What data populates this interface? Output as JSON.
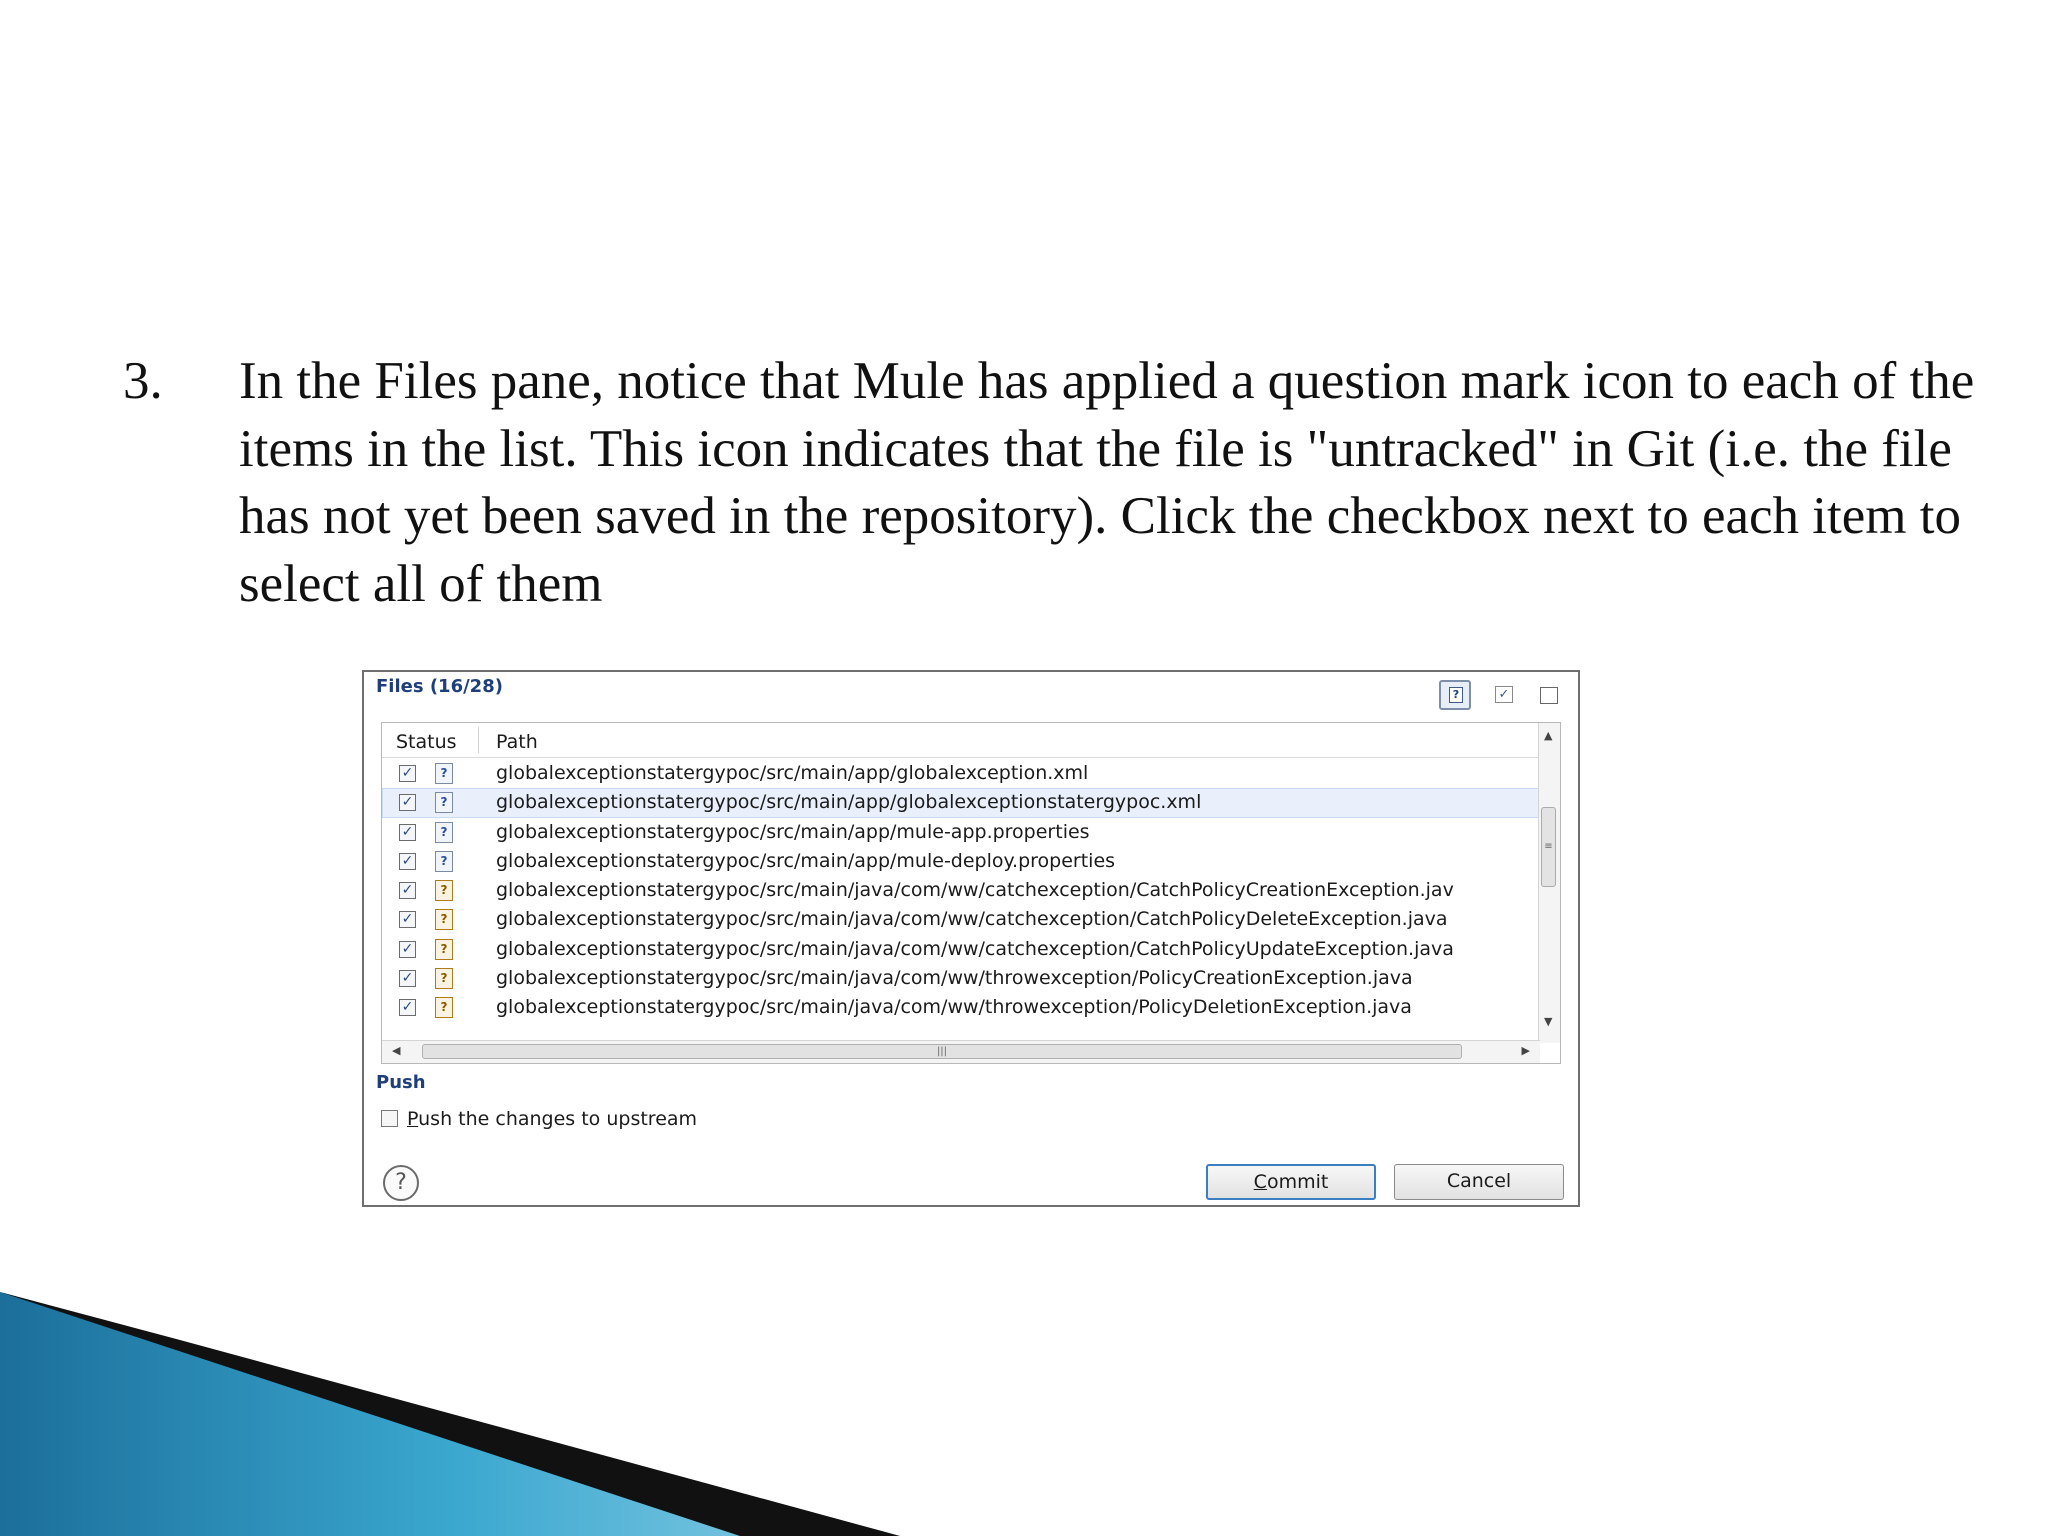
{
  "instruction": {
    "number": "3.",
    "text": "In the Files pane, notice that Mule has applied a question mark icon to each of the items in the list. This icon indicates that the file is \"untracked\" in Git (i.e. the file has not yet been saved in the repository). Click the checkbox next to each item to select all of them"
  },
  "dialog": {
    "files_title": "Files (16/28)",
    "toolbar_icons": [
      "untracked-filter-icon",
      "checked-filter-icon",
      "uncheck-all-icon"
    ],
    "columns": {
      "status": "Status",
      "path": "Path"
    },
    "files": [
      {
        "path": "globalexceptionstatergypoc/src/main/app/globalexception.xml",
        "type": "xml",
        "checked": true
      },
      {
        "path": "globalexceptionstatergypoc/src/main/app/globalexceptionstatergypoc.xml",
        "type": "xml",
        "checked": true,
        "selected": true
      },
      {
        "path": "globalexceptionstatergypoc/src/main/app/mule-app.properties",
        "type": "properties",
        "checked": true
      },
      {
        "path": "globalexceptionstatergypoc/src/main/app/mule-deploy.properties",
        "type": "properties",
        "checked": true
      },
      {
        "path": "globalexceptionstatergypoc/src/main/java/com/ww/catchexception/CatchPolicyCreationException.jav",
        "type": "java",
        "checked": true
      },
      {
        "path": "globalexceptionstatergypoc/src/main/java/com/ww/catchexception/CatchPolicyDeleteException.java",
        "type": "java",
        "checked": true
      },
      {
        "path": "globalexceptionstatergypoc/src/main/java/com/ww/catchexception/CatchPolicyUpdateException.java",
        "type": "java",
        "checked": true
      },
      {
        "path": "globalexceptionstatergypoc/src/main/java/com/ww/throwexception/PolicyCreationException.java",
        "type": "java",
        "checked": true
      },
      {
        "path": "globalexceptionstatergypoc/src/main/java/com/ww/throwexception/PolicyDeletionException.java",
        "type": "java",
        "checked": true
      }
    ],
    "push": {
      "title": "Push",
      "checkbox_mnemonic": "P",
      "checkbox_rest": "ush the changes to upstream",
      "checked": false
    },
    "buttons": {
      "commit_mnemonic": "C",
      "commit_rest": "ommit",
      "cancel": "Cancel"
    }
  },
  "colors": {
    "section_title": "#1e3f7a",
    "commit_border": "#3c7fc1",
    "swoosh_dark": "#111111",
    "swoosh_blue": "#2a8fb8"
  }
}
